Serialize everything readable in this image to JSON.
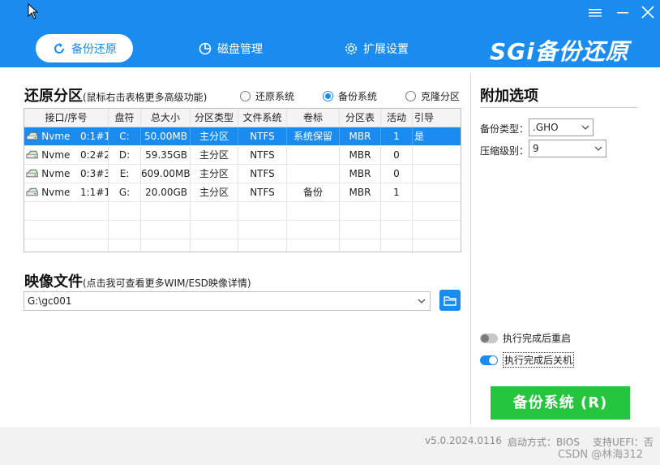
{
  "tabs": {
    "backup": "备份还原",
    "disk": "磁盘管理",
    "settings": "扩展设置"
  },
  "logo_text": "SGi备份还原",
  "partition": {
    "title": "还原分区",
    "hint": "(鼠标右击表格更多高级功能)",
    "radios": [
      {
        "label": "还原系统",
        "checked": false
      },
      {
        "label": "备份系统",
        "checked": true
      },
      {
        "label": "克隆分区",
        "checked": false
      }
    ],
    "columns": [
      "接口/序号",
      "盘符",
      "总大小",
      "分区类型",
      "文件系统",
      "卷标",
      "分区表",
      "活动",
      "引导"
    ],
    "rows": [
      {
        "iface": "Nvme",
        "index": "0:1#1",
        "drive": "C:",
        "size": "50.00MB",
        "type": "主分区",
        "fs": "NTFS",
        "label": "系统保留",
        "table": "MBR",
        "active": "1",
        "boot": "是",
        "selected": true
      },
      {
        "iface": "Nvme",
        "index": "0:2#2",
        "drive": "D:",
        "size": "59.35GB",
        "type": "主分区",
        "fs": "NTFS",
        "label": "",
        "table": "MBR",
        "active": "0",
        "boot": "",
        "selected": false
      },
      {
        "iface": "Nvme",
        "index": "0:3#3",
        "drive": "E:",
        "size": "609.00MB",
        "type": "主分区",
        "fs": "NTFS",
        "label": "",
        "table": "MBR",
        "active": "0",
        "boot": "",
        "selected": false
      },
      {
        "iface": "Nvme",
        "index": "1:1#1",
        "drive": "G:",
        "size": "20.00GB",
        "type": "主分区",
        "fs": "NTFS",
        "label": "备份",
        "table": "MBR",
        "active": "1",
        "boot": "",
        "selected": false
      }
    ]
  },
  "image_file": {
    "title": "映像文件",
    "hint": "(点击我可查看更多WIM/ESD映像详情)",
    "path": "G:\\gc001"
  },
  "options": {
    "title": "附加选项",
    "backup_type_label": "备份类型：",
    "backup_type_value": ".GHO",
    "compress_label": "压缩级别：",
    "compress_value": "9",
    "reboot_label": "执行完成后重启",
    "reboot_on": false,
    "shutdown_label": "执行完成后关机",
    "shutdown_on": true
  },
  "start_button": "备份系统 (R)",
  "footer": {
    "version": "v5.0.2024.0116",
    "boot_mode": "启动方式：BIOS",
    "uefi": "支持UEFI：否"
  },
  "watermark": "CSDN @林海312",
  "colors": {
    "accent": "#1a8cf0",
    "start_button": "#25c63d"
  }
}
